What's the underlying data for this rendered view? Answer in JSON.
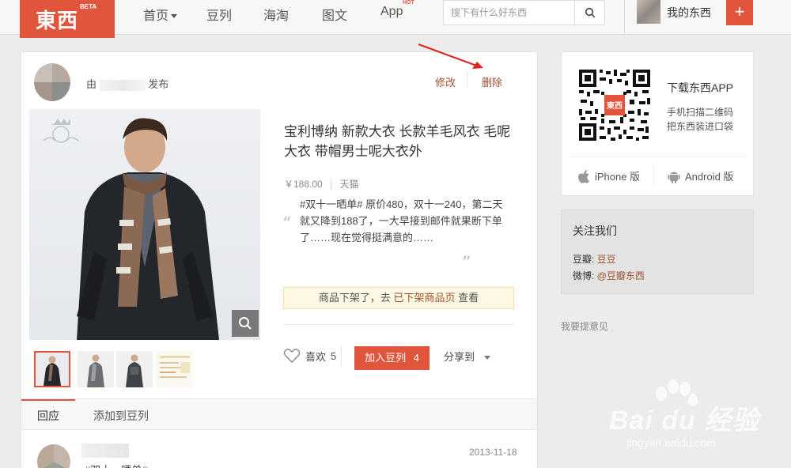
{
  "header": {
    "logo_text": "東西",
    "logo_badge": "BETA",
    "nav": [
      {
        "label": "首页",
        "has_dropdown": true
      },
      {
        "label": "豆列"
      },
      {
        "label": "海淘"
      },
      {
        "label": "图文"
      },
      {
        "label": "App",
        "badge": "HOT"
      }
    ],
    "search_placeholder": "搜下有什么好东西",
    "my_stuff": "我的东西",
    "plus_label": "+"
  },
  "post": {
    "by_prefix": "由",
    "by_suffix": "发布",
    "edit_label": "修改",
    "delete_label": "删除",
    "title": "宝利博纳 新款大衣 长款羊毛风衣 毛呢大衣 带帽男士呢大衣外",
    "price": "￥188.00",
    "price_sep": "|",
    "store": "天猫",
    "quote_open": "“",
    "quote": "#双十一晒单# 原价480，双十一240，第二天就又降到188了，一大早接到邮件就果断下单了……现在觉得挺满意的……",
    "quote_close": "”",
    "notice_prefix": "商品下架了，去",
    "notice_link": "已下架商品页",
    "notice_suffix": "查看",
    "like_label": "喜欢",
    "like_count": "5",
    "add_label": "加入豆列",
    "add_count": "4",
    "share_label": "分享到"
  },
  "tabs": [
    {
      "label": "回应",
      "active": true
    },
    {
      "label": "添加到豆列"
    }
  ],
  "comment": {
    "date": "2013-11-18",
    "text": "#双十一晒单#"
  },
  "sidebar": {
    "app_title": "下载东西APP",
    "app_desc_1": "手机扫描二维码",
    "app_desc_2": "把东西装进口袋",
    "qr_badge": "東西",
    "iphone_label": "iPhone 版",
    "android_label": "Android 版",
    "follow_title": "关注我们",
    "douban_label": "豆瓣:",
    "douban_link": "豆豆",
    "weibo_label": "微博:",
    "weibo_link": "@豆瓣东西",
    "feedback": "我要提意见"
  },
  "watermark": {
    "text": "Bai du 经验",
    "sub": "jingyan.baidu.com"
  },
  "colors": {
    "brand": "#e2553d",
    "link": "#a0522d",
    "notice_bg": "#fdf8e3"
  }
}
